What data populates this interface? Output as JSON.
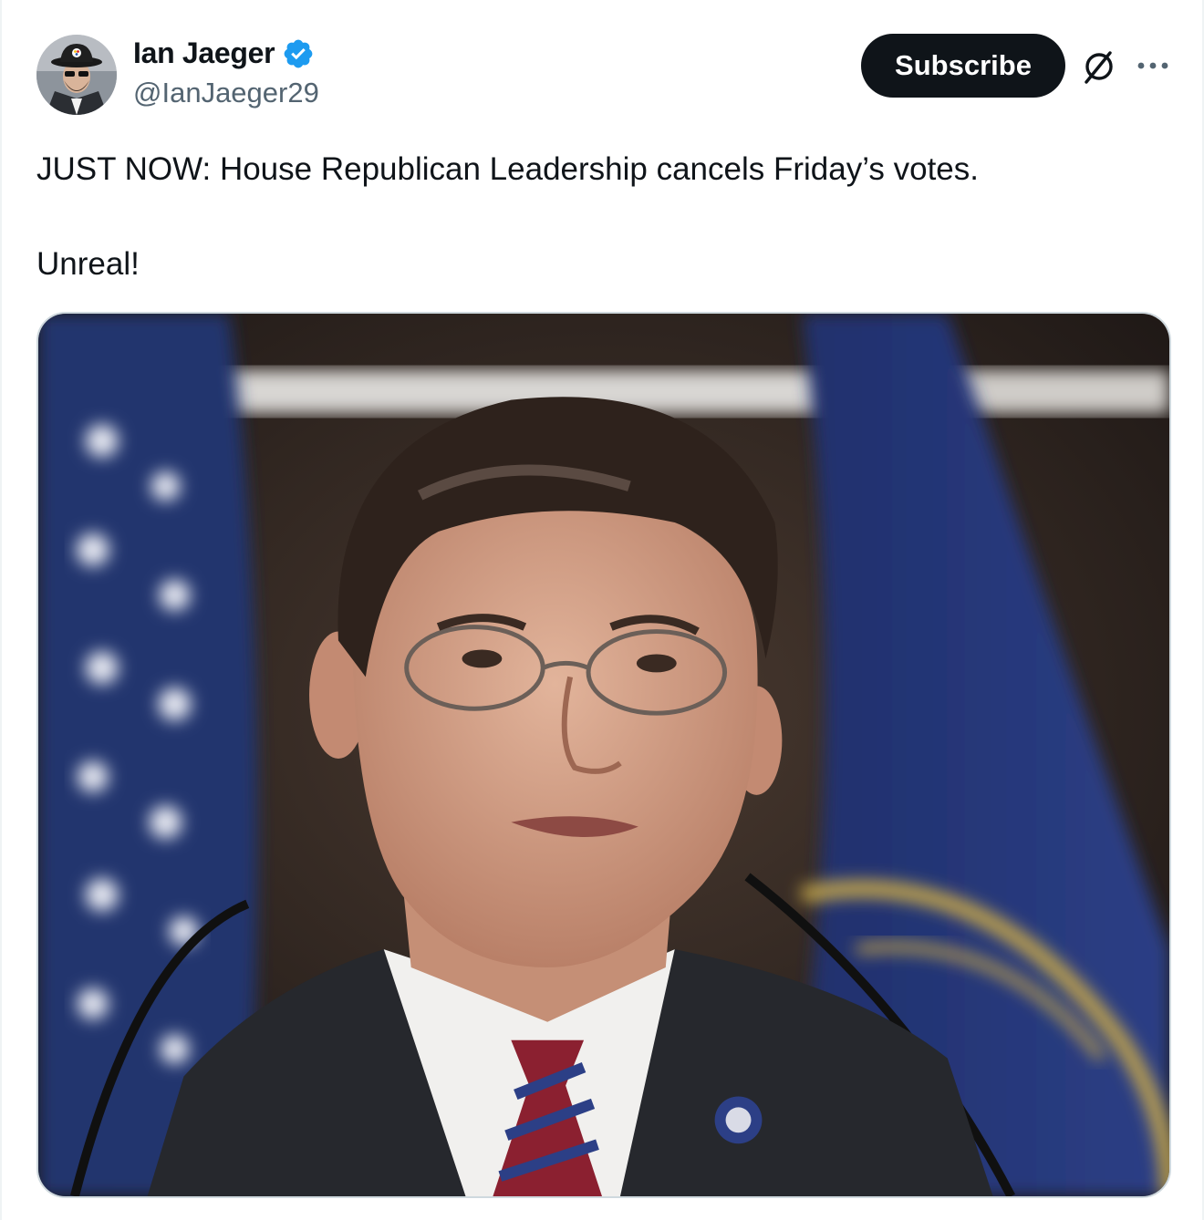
{
  "author": {
    "display_name": "Ian Jaeger",
    "handle": "@IanJaeger29",
    "verified": true,
    "verified_color": "#1d9bf0"
  },
  "actions": {
    "subscribe_label": "Subscribe",
    "grok_icon": "grok-icon",
    "more_icon": "more-icon"
  },
  "post": {
    "paragraphs": [
      "JUST NOW: House Republican Leadership cancels Friday’s votes.",
      "Unreal!"
    ]
  },
  "media": {
    "type": "photo"
  }
}
